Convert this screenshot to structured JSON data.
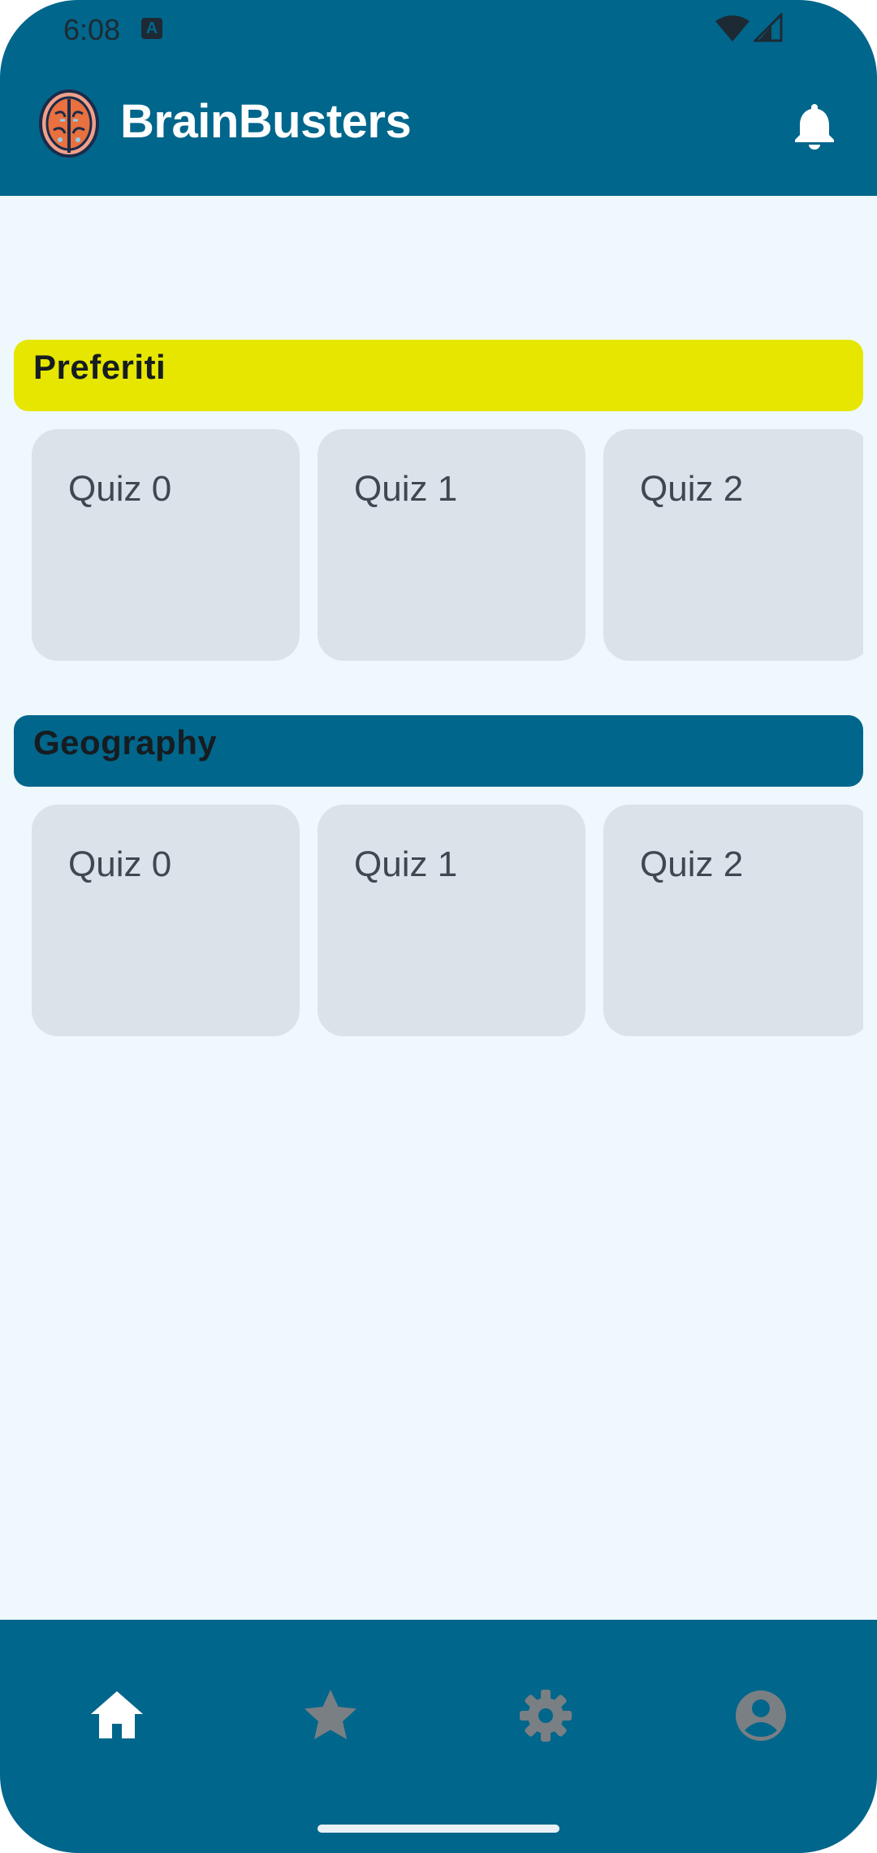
{
  "status_bar": {
    "time": "6:08",
    "notification_icon": "a-icon",
    "wifi_icon": "wifi-icon",
    "signal_icon": "signal-icon"
  },
  "app_bar": {
    "title": "BrainBusters",
    "logo_icon": "brain-logo-icon",
    "notifications_icon": "bell-icon"
  },
  "sections": [
    {
      "title": "Preferiti",
      "header_color": "#e6e600",
      "quizzes": [
        "Quiz 0",
        "Quiz 1",
        "Quiz 2"
      ]
    },
    {
      "title": "Geography",
      "header_color": "#01668b",
      "quizzes": [
        "Quiz 0",
        "Quiz 1",
        "Quiz 2"
      ]
    }
  ],
  "bottom_nav": {
    "items": [
      {
        "icon": "home-icon",
        "active": true
      },
      {
        "icon": "star-icon",
        "active": false
      },
      {
        "icon": "gear-icon",
        "active": false
      },
      {
        "icon": "account-circle-icon",
        "active": false
      }
    ]
  },
  "colors": {
    "primary": "#01668b",
    "background": "#eff8fd",
    "card": "#dce2e9",
    "favorites_accent": "#e6e600",
    "nav_active": "#ffffff",
    "nav_inactive": "#7a7f83"
  }
}
